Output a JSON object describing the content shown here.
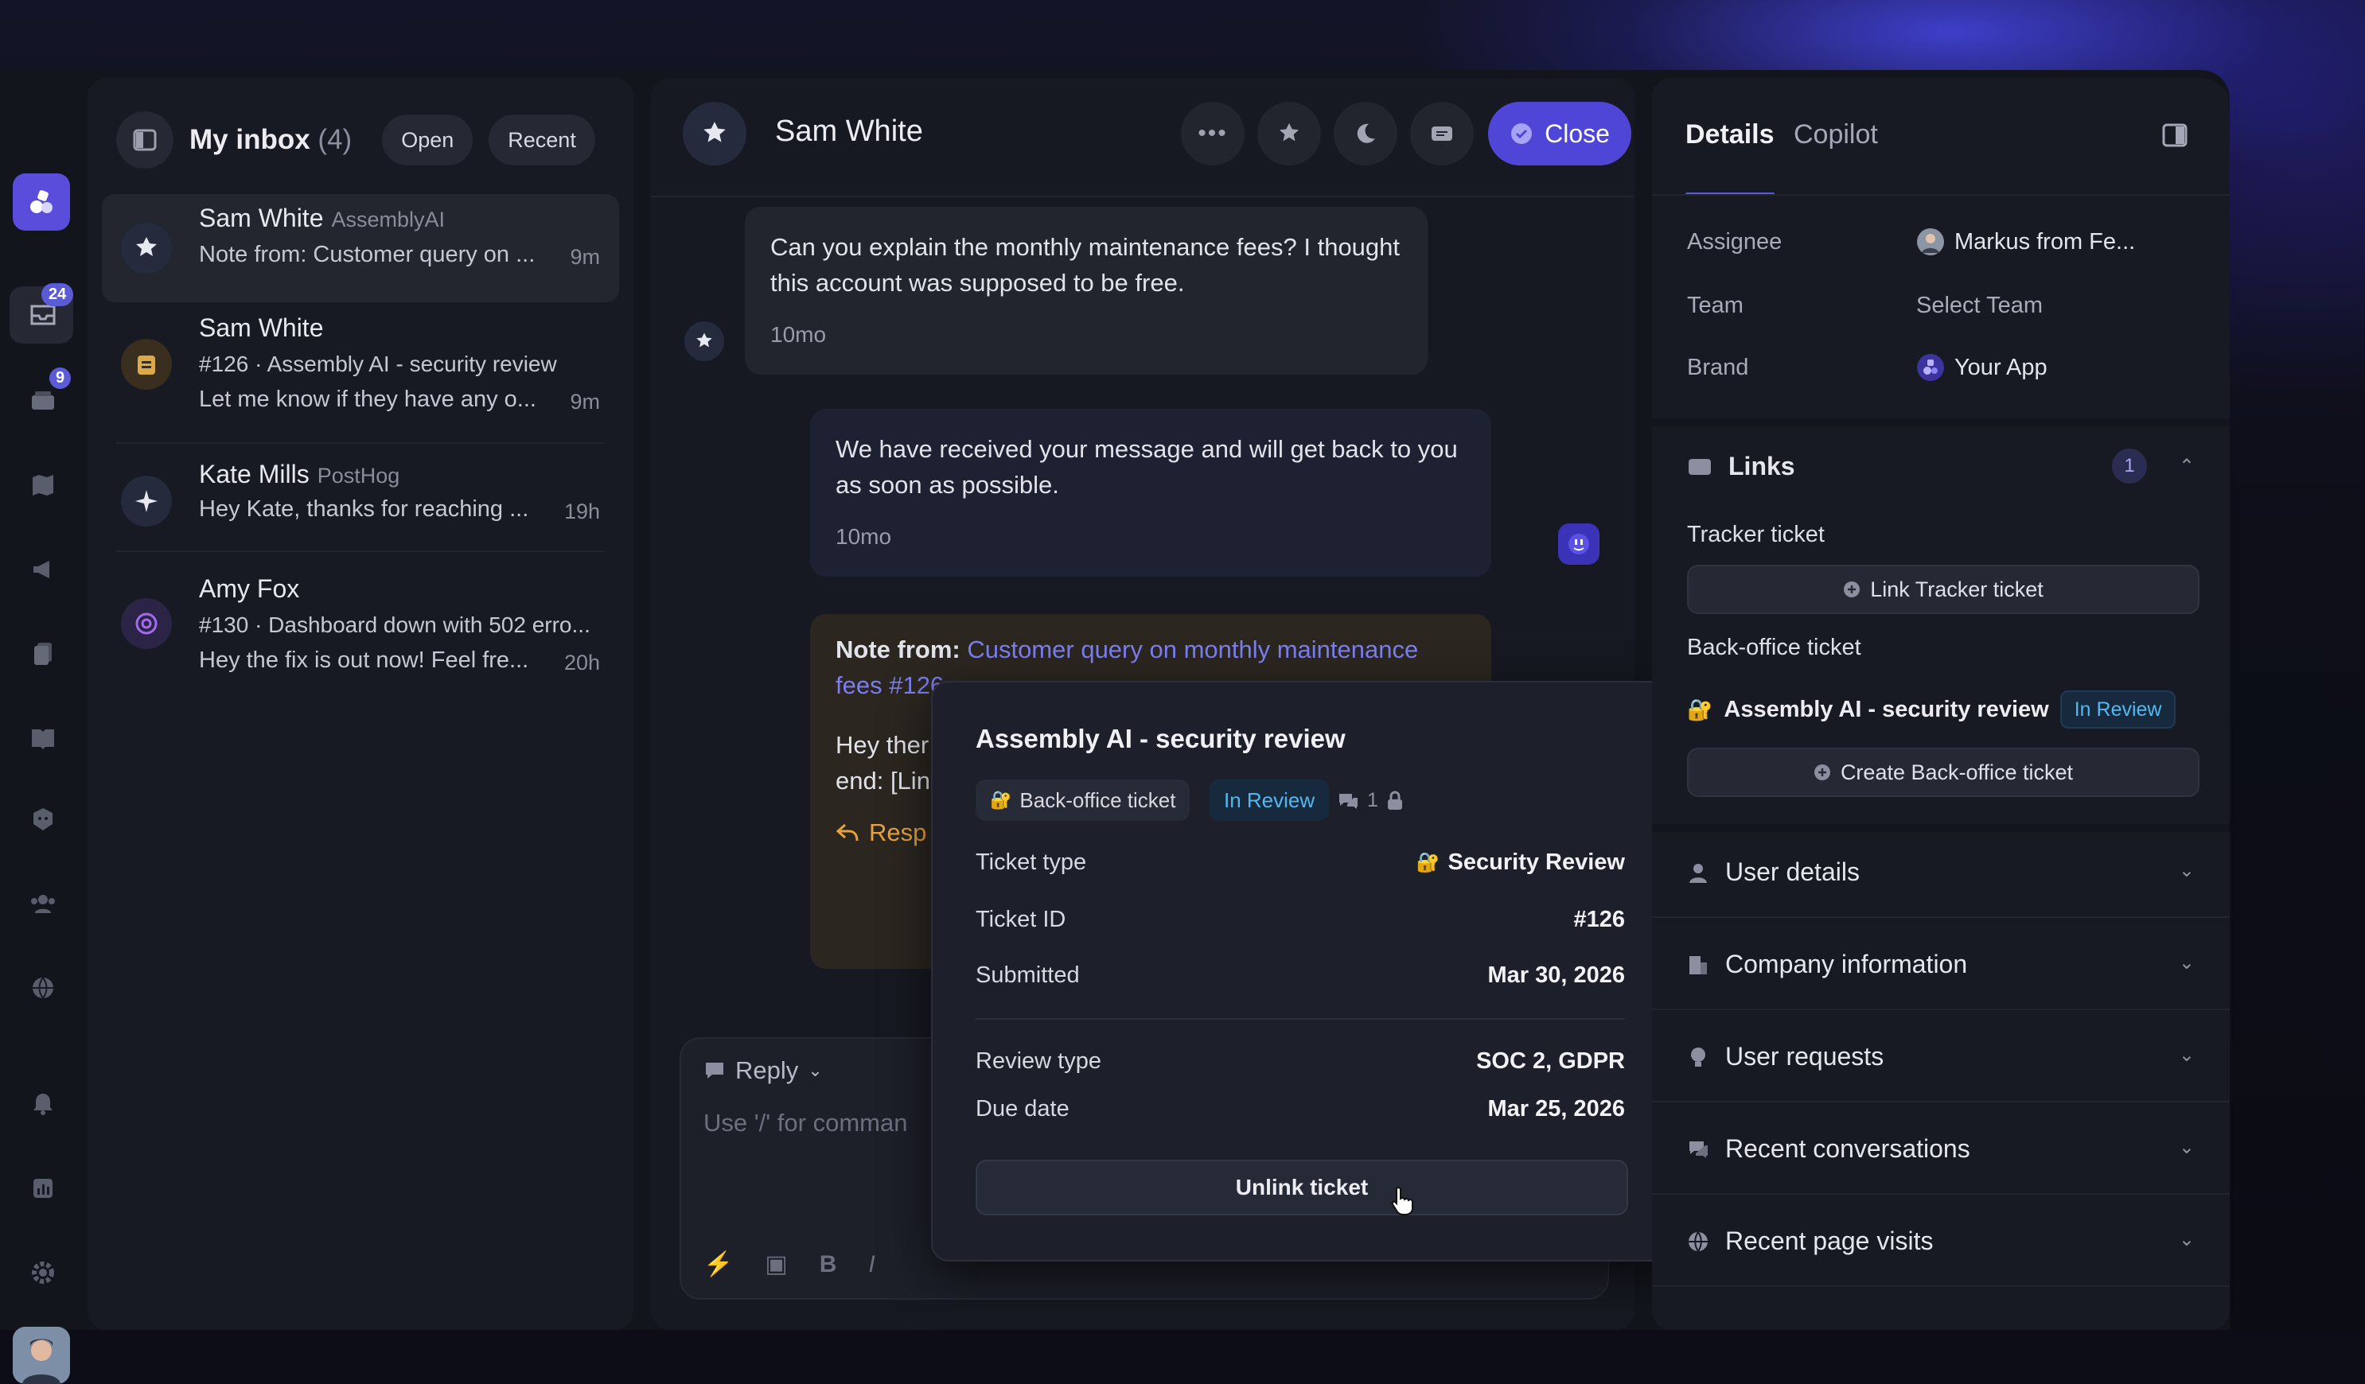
{
  "inbox": {
    "title": "My inbox",
    "count": "(4)",
    "filter_open": "Open",
    "filter_recent": "Recent"
  },
  "rail": {
    "inbox_badge": "24",
    "tickets_badge": "9"
  },
  "conversations": [
    {
      "name": "Sam White",
      "company": "AssemblyAI",
      "preview": "Note from: Customer query on ...",
      "time": "9m"
    },
    {
      "name": "Sam White",
      "subject": "#126 · Assembly AI - security review",
      "preview": "Let me know if they have any o...",
      "time": "9m"
    },
    {
      "name": "Kate Mills",
      "company": "PostHog",
      "preview": "Hey Kate, thanks for reaching ...",
      "time": "19h"
    },
    {
      "name": "Amy Fox",
      "subject": "#130 · Dashboard down with 502 erro...",
      "preview": "Hey the fix is out now! Feel fre...",
      "time": "20h"
    }
  ],
  "chat": {
    "contact": "Sam White",
    "close_label": "Close",
    "messages": [
      {
        "text": "Can you explain the monthly maintenance fees? I thought this account was supposed to be free.",
        "time": "10mo"
      },
      {
        "text": "We have received your message and will get back to you as soon as possible.",
        "time": "10mo"
      }
    ],
    "note": {
      "prefix": "Note from:",
      "link": "Customer query on monthly maintenance fees #126",
      "body_1": "Hey ther",
      "body_2": "end: [Lin",
      "respond": "Resp"
    },
    "reply": {
      "mode": "Reply",
      "placeholder": "Use '/' for comman"
    }
  },
  "popover": {
    "title": "Assembly AI - security review",
    "ticket_kind": "Back-office ticket",
    "status": "In Review",
    "comment_count": "1",
    "rows": [
      {
        "label": "Ticket type",
        "value": "Security Review"
      },
      {
        "label": "Ticket ID",
        "value": "#126"
      },
      {
        "label": "Submitted",
        "value": "Mar 30, 2026"
      },
      {
        "label": "Review type",
        "value": "SOC 2, GDPR"
      },
      {
        "label": "Due date",
        "value": "Mar 25, 2026"
      }
    ],
    "unlink_label": "Unlink ticket"
  },
  "details": {
    "tab_details": "Details",
    "tab_copilot": "Copilot",
    "assignee_label": "Assignee",
    "assignee_value": "Markus from Fe...",
    "team_label": "Team",
    "team_value": "Select Team",
    "brand_label": "Brand",
    "brand_value": "Your App",
    "links": {
      "title": "Links",
      "count": "1",
      "tracker_label": "Tracker ticket",
      "tracker_button": "Link Tracker ticket",
      "backoffice_label": "Back-office ticket",
      "backoffice_ticket": "Assembly AI - security review",
      "backoffice_status": "In Review",
      "create_button": "Create Back-office ticket"
    },
    "sections": [
      "User details",
      "Company information",
      "User requests",
      "Recent conversations",
      "Recent page visits"
    ]
  },
  "colors": {
    "accent": "#4f46d8",
    "status_blue": "#53b8f2",
    "note_bg": "#2b2620",
    "link": "#7b7ef0"
  }
}
